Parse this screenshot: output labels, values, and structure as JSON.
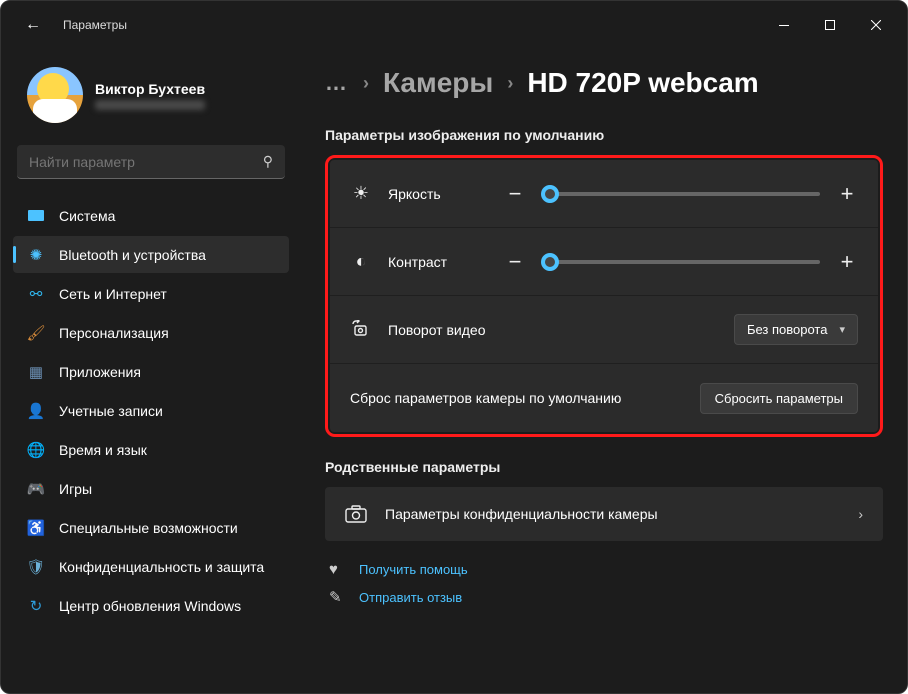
{
  "titlebar": {
    "title": "Параметры"
  },
  "profile": {
    "name": "Виктор Бухтеев"
  },
  "search": {
    "placeholder": "Найти параметр"
  },
  "sidebar": {
    "items": [
      {
        "label": "Система"
      },
      {
        "label": "Bluetooth и устройства"
      },
      {
        "label": "Сеть и Интернет"
      },
      {
        "label": "Персонализация"
      },
      {
        "label": "Приложения"
      },
      {
        "label": "Учетные записи"
      },
      {
        "label": "Время и язык"
      },
      {
        "label": "Игры"
      },
      {
        "label": "Специальные возможности"
      },
      {
        "label": "Конфиденциальность и защита"
      },
      {
        "label": "Центр обновления Windows"
      }
    ]
  },
  "breadcrumb": {
    "more": "…",
    "parent": "Камеры",
    "current": "HD 720P webcam"
  },
  "sections": {
    "image_defaults_title": "Параметры изображения по умолчанию",
    "brightness": {
      "label": "Яркость",
      "value": 3
    },
    "contrast": {
      "label": "Контраст",
      "value": 3
    },
    "rotation": {
      "label": "Поворот видео",
      "selected": "Без поворота"
    },
    "reset": {
      "label": "Сброс параметров камеры по умолчанию",
      "button": "Сбросить параметры"
    },
    "related_title": "Родственные параметры",
    "privacy": {
      "label": "Параметры конфиденциальности камеры"
    }
  },
  "footer": {
    "help": "Получить помощь",
    "feedback": "Отправить отзыв"
  }
}
